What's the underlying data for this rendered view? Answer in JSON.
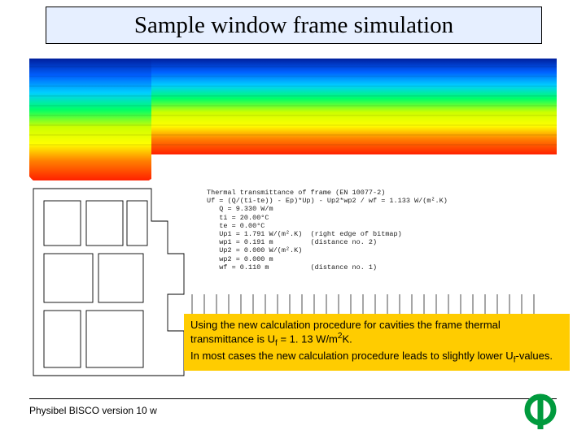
{
  "title": "Sample window frame simulation",
  "calc": {
    "l0": "Thermal transmittance of frame (EN 10077-2)",
    "l1": "Uf = (Q/(ti-te)) - Ep)*Up) - Up2*wp2 / wf = 1.133 W/(m².K)",
    "l2": "   Q = 9.330 W/m",
    "l3": "   ti = 20.00°C",
    "l4": "   te = 0.00°C",
    "l5": "   Up1 = 1.791 W/(m².K)  (right edge of bitmap)",
    "l6": "   wp1 = 0.191 m         (distance no. 2)",
    "l7": "   Up2 = 0.000 W/(m².K)",
    "l8": "   wp2 = 0.000 m",
    "l9": "   wf = 0.110 m          (distance no. 1)"
  },
  "callout": {
    "line1_a": "Using the new calculation procedure for cavities the frame thermal transmittance is U",
    "line1_sub": "f",
    "line1_b": " = 1. 13 W/m",
    "line1_sup": "2",
    "line1_c": "K.",
    "line2_a": "In most cases the new calculation procedure leads to slightly lower U",
    "line2_sub": "f",
    "line2_b": "-values."
  },
  "footer": "Physibel BISCO version 10 w",
  "logo_name": "phi-logo"
}
